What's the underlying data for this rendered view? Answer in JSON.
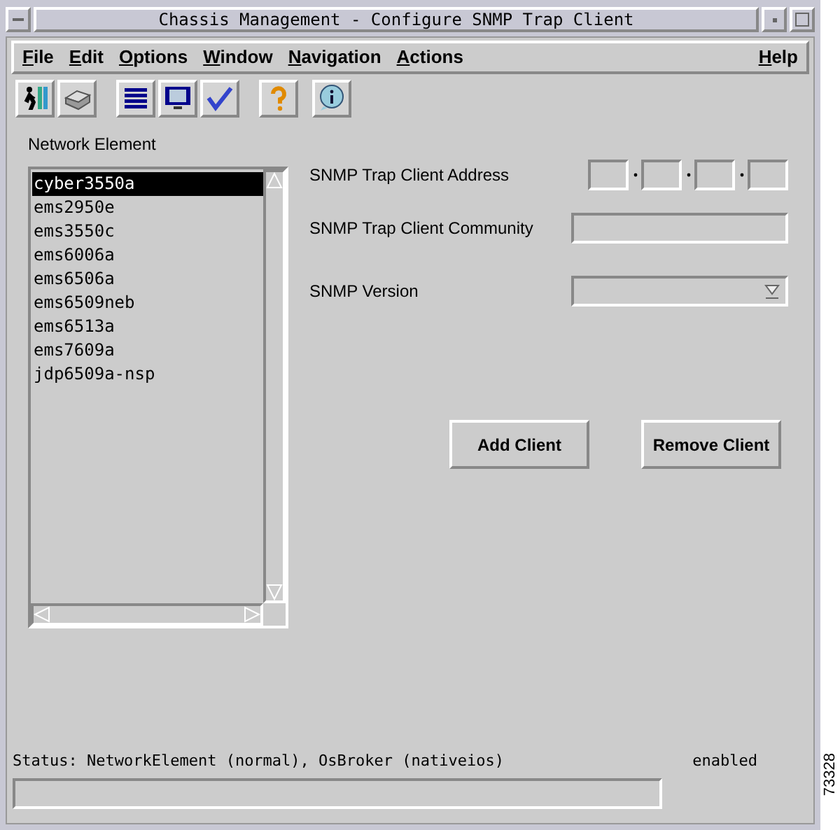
{
  "window": {
    "title": "Chassis Management - Configure SNMP Trap Client"
  },
  "menu": [
    {
      "label": "File"
    },
    {
      "label": "Edit"
    },
    {
      "label": "Options"
    },
    {
      "label": "Window"
    },
    {
      "label": "Navigation"
    },
    {
      "label": "Actions"
    }
  ],
  "help_menu": {
    "label": "Help"
  },
  "network_element": {
    "label": "Network Element",
    "items": [
      {
        "name": "cyber3550a",
        "selected": true
      },
      {
        "name": "ems2950e",
        "selected": false
      },
      {
        "name": "ems3550c",
        "selected": false
      },
      {
        "name": "ems6006a",
        "selected": false
      },
      {
        "name": "ems6506a",
        "selected": false
      },
      {
        "name": "ems6509neb",
        "selected": false
      },
      {
        "name": "ems6513a",
        "selected": false
      },
      {
        "name": "ems7609a",
        "selected": false
      },
      {
        "name": "jdp6509a-nsp",
        "selected": false
      }
    ]
  },
  "form": [
    {
      "label": "SNMP Trap Client Address",
      "kind": "ip"
    },
    {
      "label": "SNMP Trap Client Community",
      "kind": "text"
    },
    {
      "label": "SNMP Version",
      "kind": "select"
    }
  ],
  "buttons": [
    "Add Client",
    "Remove Client"
  ],
  "status_bar": {
    "text": "Status: NetworkElement (normal), OsBroker (nativeios)",
    "state": "enabled"
  },
  "figure_number": "73328"
}
